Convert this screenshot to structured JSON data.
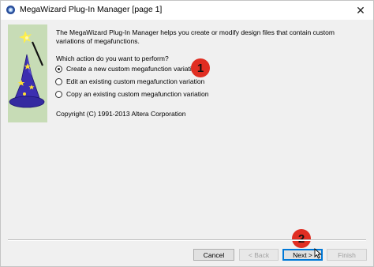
{
  "window": {
    "title": "MegaWizard Plug-In Manager [page 1]",
    "close_glyph": "✕"
  },
  "main": {
    "description": "The MegaWizard Plug-In Manager helps you create or modify design files that contain custom variations of megafunctions.",
    "question": "Which action do you want to perform?",
    "options": [
      {
        "label": "Create a new custom megafunction variation",
        "selected": true
      },
      {
        "label": "Edit an existing custom megafunction variation",
        "selected": false
      },
      {
        "label": "Copy an existing custom megafunction variation",
        "selected": false
      }
    ],
    "copyright": "Copyright (C) 1991-2013 Altera Corporation"
  },
  "annotations": {
    "step1": "1",
    "step2": "2"
  },
  "footer": {
    "cancel_label": "Cancel",
    "back_label": "< Back",
    "next_label": "Next >",
    "finish_label": "Finish"
  },
  "colors": {
    "panel": "#c7dcb6",
    "badge": "#e02e22",
    "default_button_border": "#0078d7"
  }
}
